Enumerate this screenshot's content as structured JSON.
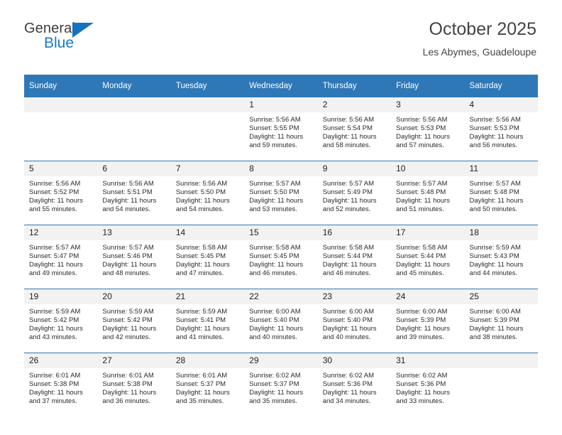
{
  "brand": {
    "name_part1": "General",
    "name_part2": "Blue",
    "triangle_icon": "triangle-icon",
    "color_dark": "#3c3c3c",
    "color_blue": "#1a79c4"
  },
  "header": {
    "title": "October 2025",
    "subtitle": "Les Abymes, Guadeloupe",
    "accent_color": "#2e78b7",
    "daynum_bg": "#f2f2f2"
  },
  "calendar": {
    "weekday_headers": [
      "Sunday",
      "Monday",
      "Tuesday",
      "Wednesday",
      "Thursday",
      "Friday",
      "Saturday"
    ],
    "labels": {
      "sunrise": "Sunrise:",
      "sunset": "Sunset:",
      "daylight": "Daylight:"
    },
    "weeks": [
      [
        {
          "day": "",
          "empty": true
        },
        {
          "day": "",
          "empty": true
        },
        {
          "day": "",
          "empty": true
        },
        {
          "day": "1",
          "sunrise": "Sunrise: 5:56 AM",
          "sunset": "Sunset: 5:55 PM",
          "daylight": "Daylight: 11 hours and 59 minutes."
        },
        {
          "day": "2",
          "sunrise": "Sunrise: 5:56 AM",
          "sunset": "Sunset: 5:54 PM",
          "daylight": "Daylight: 11 hours and 58 minutes."
        },
        {
          "day": "3",
          "sunrise": "Sunrise: 5:56 AM",
          "sunset": "Sunset: 5:53 PM",
          "daylight": "Daylight: 11 hours and 57 minutes."
        },
        {
          "day": "4",
          "sunrise": "Sunrise: 5:56 AM",
          "sunset": "Sunset: 5:53 PM",
          "daylight": "Daylight: 11 hours and 56 minutes."
        }
      ],
      [
        {
          "day": "5",
          "sunrise": "Sunrise: 5:56 AM",
          "sunset": "Sunset: 5:52 PM",
          "daylight": "Daylight: 11 hours and 55 minutes."
        },
        {
          "day": "6",
          "sunrise": "Sunrise: 5:56 AM",
          "sunset": "Sunset: 5:51 PM",
          "daylight": "Daylight: 11 hours and 54 minutes."
        },
        {
          "day": "7",
          "sunrise": "Sunrise: 5:56 AM",
          "sunset": "Sunset: 5:50 PM",
          "daylight": "Daylight: 11 hours and 54 minutes."
        },
        {
          "day": "8",
          "sunrise": "Sunrise: 5:57 AM",
          "sunset": "Sunset: 5:50 PM",
          "daylight": "Daylight: 11 hours and 53 minutes."
        },
        {
          "day": "9",
          "sunrise": "Sunrise: 5:57 AM",
          "sunset": "Sunset: 5:49 PM",
          "daylight": "Daylight: 11 hours and 52 minutes."
        },
        {
          "day": "10",
          "sunrise": "Sunrise: 5:57 AM",
          "sunset": "Sunset: 5:48 PM",
          "daylight": "Daylight: 11 hours and 51 minutes."
        },
        {
          "day": "11",
          "sunrise": "Sunrise: 5:57 AM",
          "sunset": "Sunset: 5:48 PM",
          "daylight": "Daylight: 11 hours and 50 minutes."
        }
      ],
      [
        {
          "day": "12",
          "sunrise": "Sunrise: 5:57 AM",
          "sunset": "Sunset: 5:47 PM",
          "daylight": "Daylight: 11 hours and 49 minutes."
        },
        {
          "day": "13",
          "sunrise": "Sunrise: 5:57 AM",
          "sunset": "Sunset: 5:46 PM",
          "daylight": "Daylight: 11 hours and 48 minutes."
        },
        {
          "day": "14",
          "sunrise": "Sunrise: 5:58 AM",
          "sunset": "Sunset: 5:45 PM",
          "daylight": "Daylight: 11 hours and 47 minutes."
        },
        {
          "day": "15",
          "sunrise": "Sunrise: 5:58 AM",
          "sunset": "Sunset: 5:45 PM",
          "daylight": "Daylight: 11 hours and 46 minutes."
        },
        {
          "day": "16",
          "sunrise": "Sunrise: 5:58 AM",
          "sunset": "Sunset: 5:44 PM",
          "daylight": "Daylight: 11 hours and 46 minutes."
        },
        {
          "day": "17",
          "sunrise": "Sunrise: 5:58 AM",
          "sunset": "Sunset: 5:44 PM",
          "daylight": "Daylight: 11 hours and 45 minutes."
        },
        {
          "day": "18",
          "sunrise": "Sunrise: 5:59 AM",
          "sunset": "Sunset: 5:43 PM",
          "daylight": "Daylight: 11 hours and 44 minutes."
        }
      ],
      [
        {
          "day": "19",
          "sunrise": "Sunrise: 5:59 AM",
          "sunset": "Sunset: 5:42 PM",
          "daylight": "Daylight: 11 hours and 43 minutes."
        },
        {
          "day": "20",
          "sunrise": "Sunrise: 5:59 AM",
          "sunset": "Sunset: 5:42 PM",
          "daylight": "Daylight: 11 hours and 42 minutes."
        },
        {
          "day": "21",
          "sunrise": "Sunrise: 5:59 AM",
          "sunset": "Sunset: 5:41 PM",
          "daylight": "Daylight: 11 hours and 41 minutes."
        },
        {
          "day": "22",
          "sunrise": "Sunrise: 6:00 AM",
          "sunset": "Sunset: 5:40 PM",
          "daylight": "Daylight: 11 hours and 40 minutes."
        },
        {
          "day": "23",
          "sunrise": "Sunrise: 6:00 AM",
          "sunset": "Sunset: 5:40 PM",
          "daylight": "Daylight: 11 hours and 40 minutes."
        },
        {
          "day": "24",
          "sunrise": "Sunrise: 6:00 AM",
          "sunset": "Sunset: 5:39 PM",
          "daylight": "Daylight: 11 hours and 39 minutes."
        },
        {
          "day": "25",
          "sunrise": "Sunrise: 6:00 AM",
          "sunset": "Sunset: 5:39 PM",
          "daylight": "Daylight: 11 hours and 38 minutes."
        }
      ],
      [
        {
          "day": "26",
          "sunrise": "Sunrise: 6:01 AM",
          "sunset": "Sunset: 5:38 PM",
          "daylight": "Daylight: 11 hours and 37 minutes."
        },
        {
          "day": "27",
          "sunrise": "Sunrise: 6:01 AM",
          "sunset": "Sunset: 5:38 PM",
          "daylight": "Daylight: 11 hours and 36 minutes."
        },
        {
          "day": "28",
          "sunrise": "Sunrise: 6:01 AM",
          "sunset": "Sunset: 5:37 PM",
          "daylight": "Daylight: 11 hours and 35 minutes."
        },
        {
          "day": "29",
          "sunrise": "Sunrise: 6:02 AM",
          "sunset": "Sunset: 5:37 PM",
          "daylight": "Daylight: 11 hours and 35 minutes."
        },
        {
          "day": "30",
          "sunrise": "Sunrise: 6:02 AM",
          "sunset": "Sunset: 5:36 PM",
          "daylight": "Daylight: 11 hours and 34 minutes."
        },
        {
          "day": "31",
          "sunrise": "Sunrise: 6:02 AM",
          "sunset": "Sunset: 5:36 PM",
          "daylight": "Daylight: 11 hours and 33 minutes."
        },
        {
          "day": "",
          "empty": true
        }
      ]
    ]
  }
}
